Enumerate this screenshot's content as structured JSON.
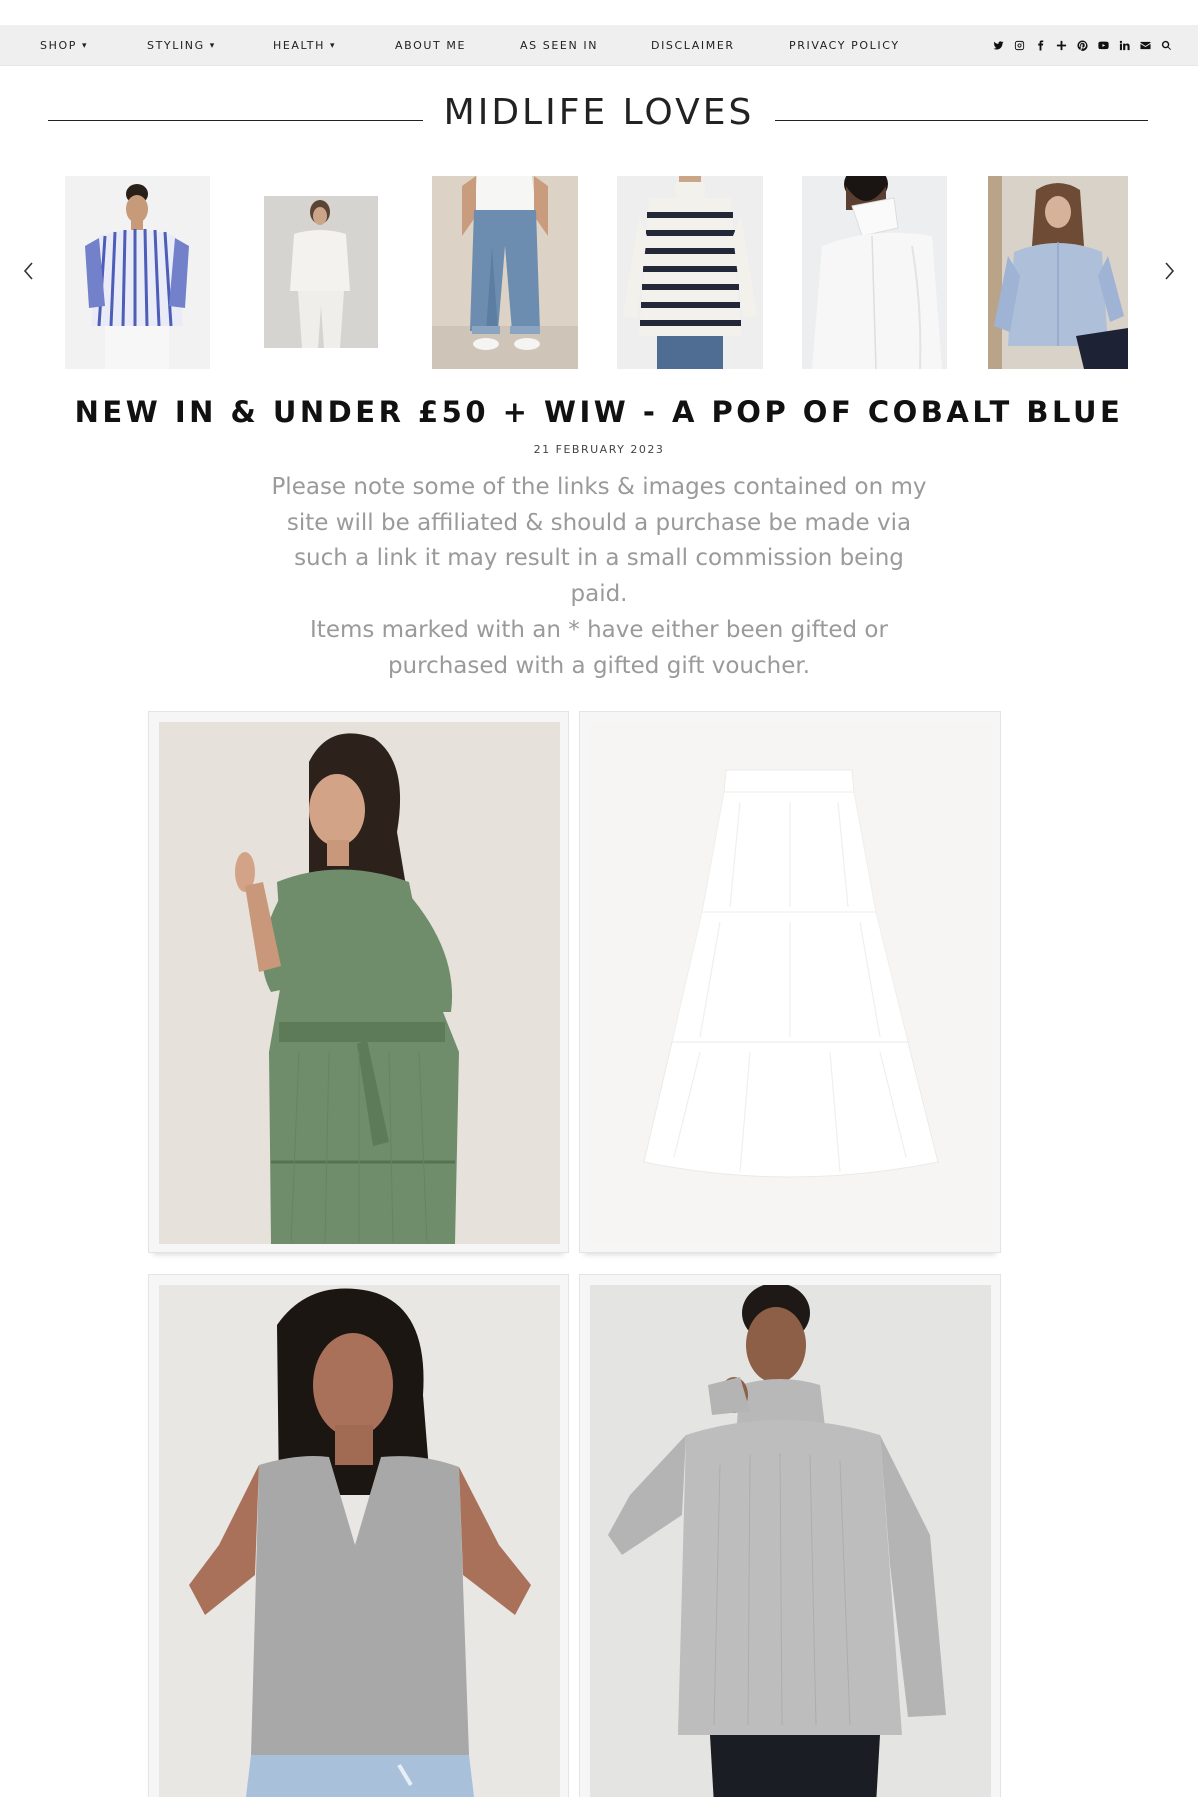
{
  "nav": {
    "items": [
      {
        "label": "SHOP",
        "has_dropdown": true
      },
      {
        "label": "STYLING",
        "has_dropdown": true
      },
      {
        "label": "HEALTH",
        "has_dropdown": true
      },
      {
        "label": "ABOUT ME",
        "has_dropdown": false
      },
      {
        "label": "AS SEEN IN",
        "has_dropdown": false
      },
      {
        "label": "DISCLAIMER",
        "has_dropdown": false
      },
      {
        "label": "PRIVACY POLICY",
        "has_dropdown": false
      }
    ],
    "dropdown_glyph": "▾",
    "social_icons": [
      "twitter-icon",
      "instagram-icon",
      "facebook-icon",
      "bloglovin-icon",
      "pinterest-icon",
      "youtube-icon",
      "linkedin-icon",
      "email-icon",
      "search-icon"
    ]
  },
  "site": {
    "title": "MIDLIFE LOVES"
  },
  "carousel": {
    "items": [
      {
        "alt": "Model in blue and white striped shirt"
      },
      {
        "alt": "Model in white shirt and white trousers"
      },
      {
        "alt": "Model in blue jeans and white trainers"
      },
      {
        "alt": "Model in navy and white striped roll neck jumper"
      },
      {
        "alt": "Model in white high neck shirt"
      },
      {
        "alt": "Model in pale blue oxford shirt"
      }
    ],
    "prev_icon": "chevron-left-icon",
    "next_icon": "chevron-right-icon"
  },
  "post": {
    "title": "NEW IN & UNDER £50 + WIW - A POP OF COBALT BLUE",
    "date": "21 FEBRUARY 2023",
    "disclaimer": {
      "line1": "Please note some of the links & images contained on my site will be affiliated & should a purchase be made via such a link it may result in a small commission being paid.",
      "line2": "Items marked with an * have either been gifted or purchased with a gifted gift voucher."
    }
  },
  "products": [
    {
      "alt": "Green tiered midi dress with tie waist"
    },
    {
      "alt": "White tiered cotton midi skirt"
    },
    {
      "alt": "Grey marl v-neck vest top"
    },
    {
      "alt": "Grey ribbed roll neck jumper"
    }
  ],
  "colors": {
    "nav_bg": "#efefef",
    "text_dark": "#222222",
    "disclaimer_grey": "#9a9a9a",
    "card_bg": "#f6f6f6"
  }
}
